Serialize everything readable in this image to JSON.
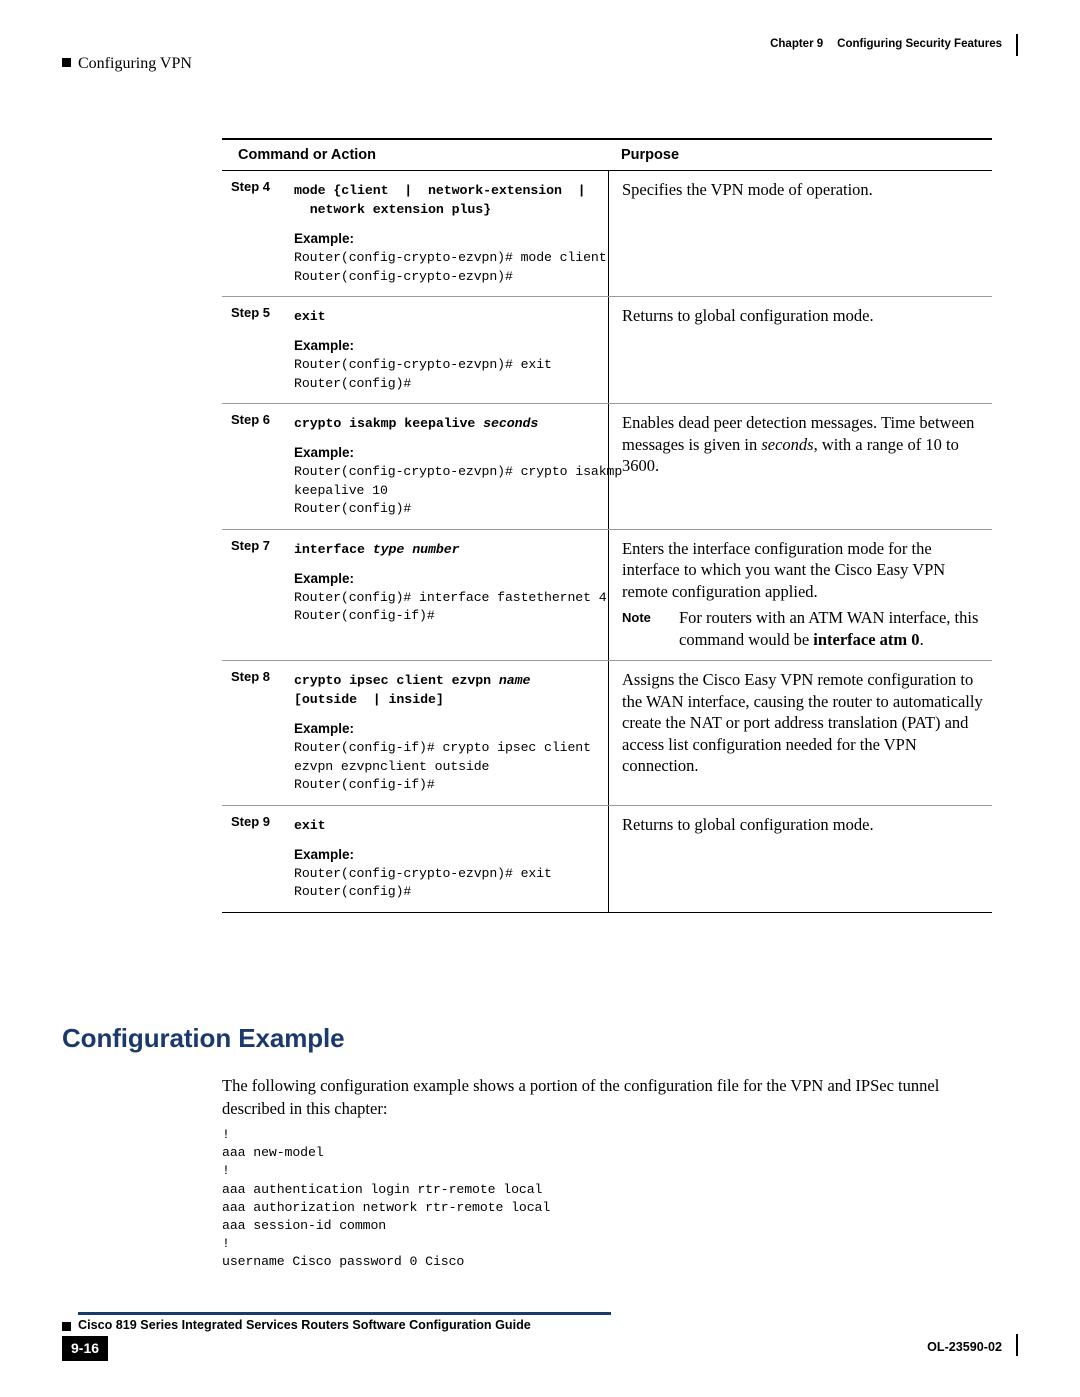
{
  "header": {
    "left_label": "Configuring VPN",
    "chapter": "Chapter 9",
    "chapter_title": "Configuring Security Features"
  },
  "table": {
    "columns": [
      "Command or Action",
      "Purpose"
    ],
    "rows": [
      {
        "step": "Step 4",
        "syntax_html": "mode {client&nbsp;&nbsp;|&nbsp;&nbsp;network-extension&nbsp;&nbsp;|&nbsp;&nbsp;network extension plus}",
        "example_label": "Example:",
        "code": "Router(config-crypto-ezvpn)# mode client\nRouter(config-crypto-ezvpn)#",
        "purpose_html": "Specifies the VPN mode of operation."
      },
      {
        "step": "Step 5",
        "syntax_html": "exit",
        "example_label": "Example:",
        "code": "Router(config-crypto-ezvpn)# exit\nRouter(config)#",
        "purpose_html": "Returns to global configuration mode."
      },
      {
        "step": "Step 6",
        "syntax_html": "crypto isakmp keepalive <i>seconds</i>",
        "example_label": "Example:",
        "code": "Router(config-crypto-ezvpn)# crypto isakmp\nkeepalive 10\nRouter(config)#",
        "purpose_html": "Enables dead peer detection messages. Time between messages is given in <i>seconds</i>, with a range of 10 to 3600."
      },
      {
        "step": "Step 7",
        "syntax_html": "interface <i>type number</i>",
        "example_label": "Example:",
        "code": "Router(config)# interface fastethernet 4\nRouter(config-if)#",
        "purpose_html": "Enters the interface configuration mode for the interface to which you want the Cisco Easy VPN remote configuration applied.",
        "note_label": "Note",
        "note_html": "For routers with an ATM WAN interface, this command would be <b>interface atm 0</b>."
      },
      {
        "step": "Step 8",
        "syntax_html": "crypto ipsec client ezvpn <i>name</i> [outside&nbsp;&nbsp;| inside]",
        "example_label": "Example:",
        "code": "Router(config-if)# crypto ipsec client\nezvpn ezvpnclient outside\nRouter(config-if)#",
        "purpose_html": "Assigns the Cisco Easy VPN remote configuration to the WAN interface, causing the router to automatically create the NAT or port address translation (PAT) and access list configuration needed for the VPN connection."
      },
      {
        "step": "Step 9",
        "syntax_html": "exit",
        "example_label": "Example:",
        "code": "Router(config-crypto-ezvpn)# exit\nRouter(config)#",
        "purpose_html": "Returns to global configuration mode."
      }
    ]
  },
  "section": {
    "title": "Configuration Example",
    "paragraph": "The following configuration example shows a portion of the configuration file for the VPN and IPSec tunnel described in this chapter:",
    "code": "!\naaa new-model\n!\naaa authentication login rtr-remote local\naaa authorization network rtr-remote local\naaa session-id common\n!\nusername Cisco password 0 Cisco"
  },
  "footer": {
    "guide_title": "Cisco 819 Series Integrated Services Routers Software Configuration Guide",
    "page_number": "9-16",
    "doc_number": "OL-23590-02"
  }
}
